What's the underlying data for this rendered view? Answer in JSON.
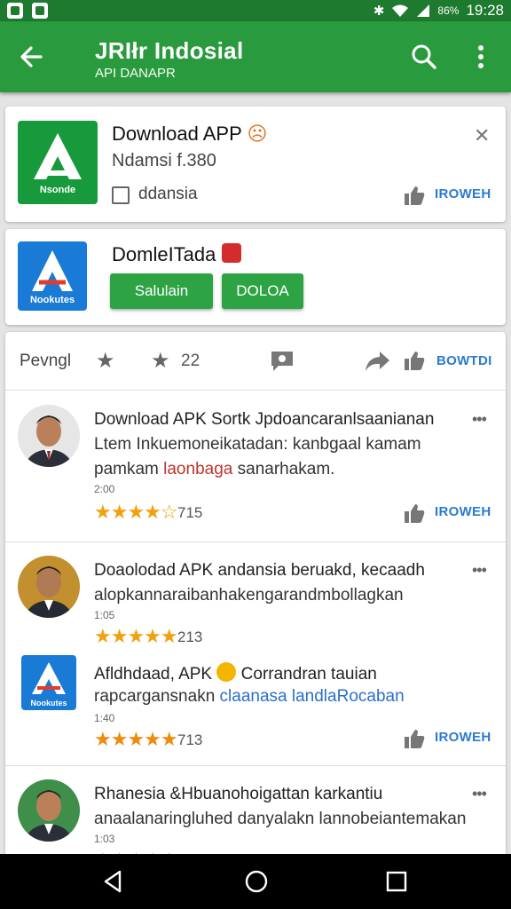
{
  "status_bar": {
    "time": "19:28",
    "battery": "86%"
  },
  "app_bar": {
    "title": "JRIłr Indosial",
    "subtitle": "API DANAPR"
  },
  "promo_card": {
    "app_name": "Download APP",
    "subtitle": "Ndamsi f.380",
    "icon_label": "Nsonde",
    "checkbox_label": "ddansia",
    "action_label": "IROWEH"
  },
  "install_card": {
    "app_name": "DomleITada",
    "icon_label": "Nookutes",
    "primary_button": "Salulain",
    "secondary_button": "DOLOA"
  },
  "reviews_header": {
    "label": "Pevngl",
    "count": "22",
    "action_label": "BOWTDI"
  },
  "reviews": [
    {
      "title": "Download APK Sortk Jpdoancaranlsaanianan",
      "body_line1": "Ltem Inkuemoneikatadan: kanbgaal kamam",
      "body_line2_plain": "pamkam ",
      "body_line2_highlight": "laonbaga",
      "body_line2_rest": " sanarhakam.",
      "meta": "2:00",
      "rating": "715",
      "action_label": "IROWEH"
    },
    {
      "title": "Doaolodad  APK andansia beruakd,  kecaadh",
      "body_line1": "alopkannaraibanhakengarandmbollagkan",
      "meta": "1:05",
      "rating": "213"
    },
    {
      "title": "Afldhdaad, APK",
      "title_rest": "Corrandran tauian",
      "body_plain": "rapcargansnakn ",
      "body_highlight": "claanasa landlaRocaban",
      "icon_label": "Nookutes",
      "meta": "1:40",
      "rating": "713",
      "action_label": "IROWEH"
    },
    {
      "title": "Rhanesia &Hbuanohoigattan karkantiu",
      "body_line1": "anaalanaringluhed danyalakn lannobeiantemakan",
      "meta": "1:03"
    }
  ],
  "colors": {
    "primary": "#2a9a3e",
    "status_bar": "#1d7a2e",
    "link": "#2a7bd0",
    "star": "#f0a20c"
  }
}
